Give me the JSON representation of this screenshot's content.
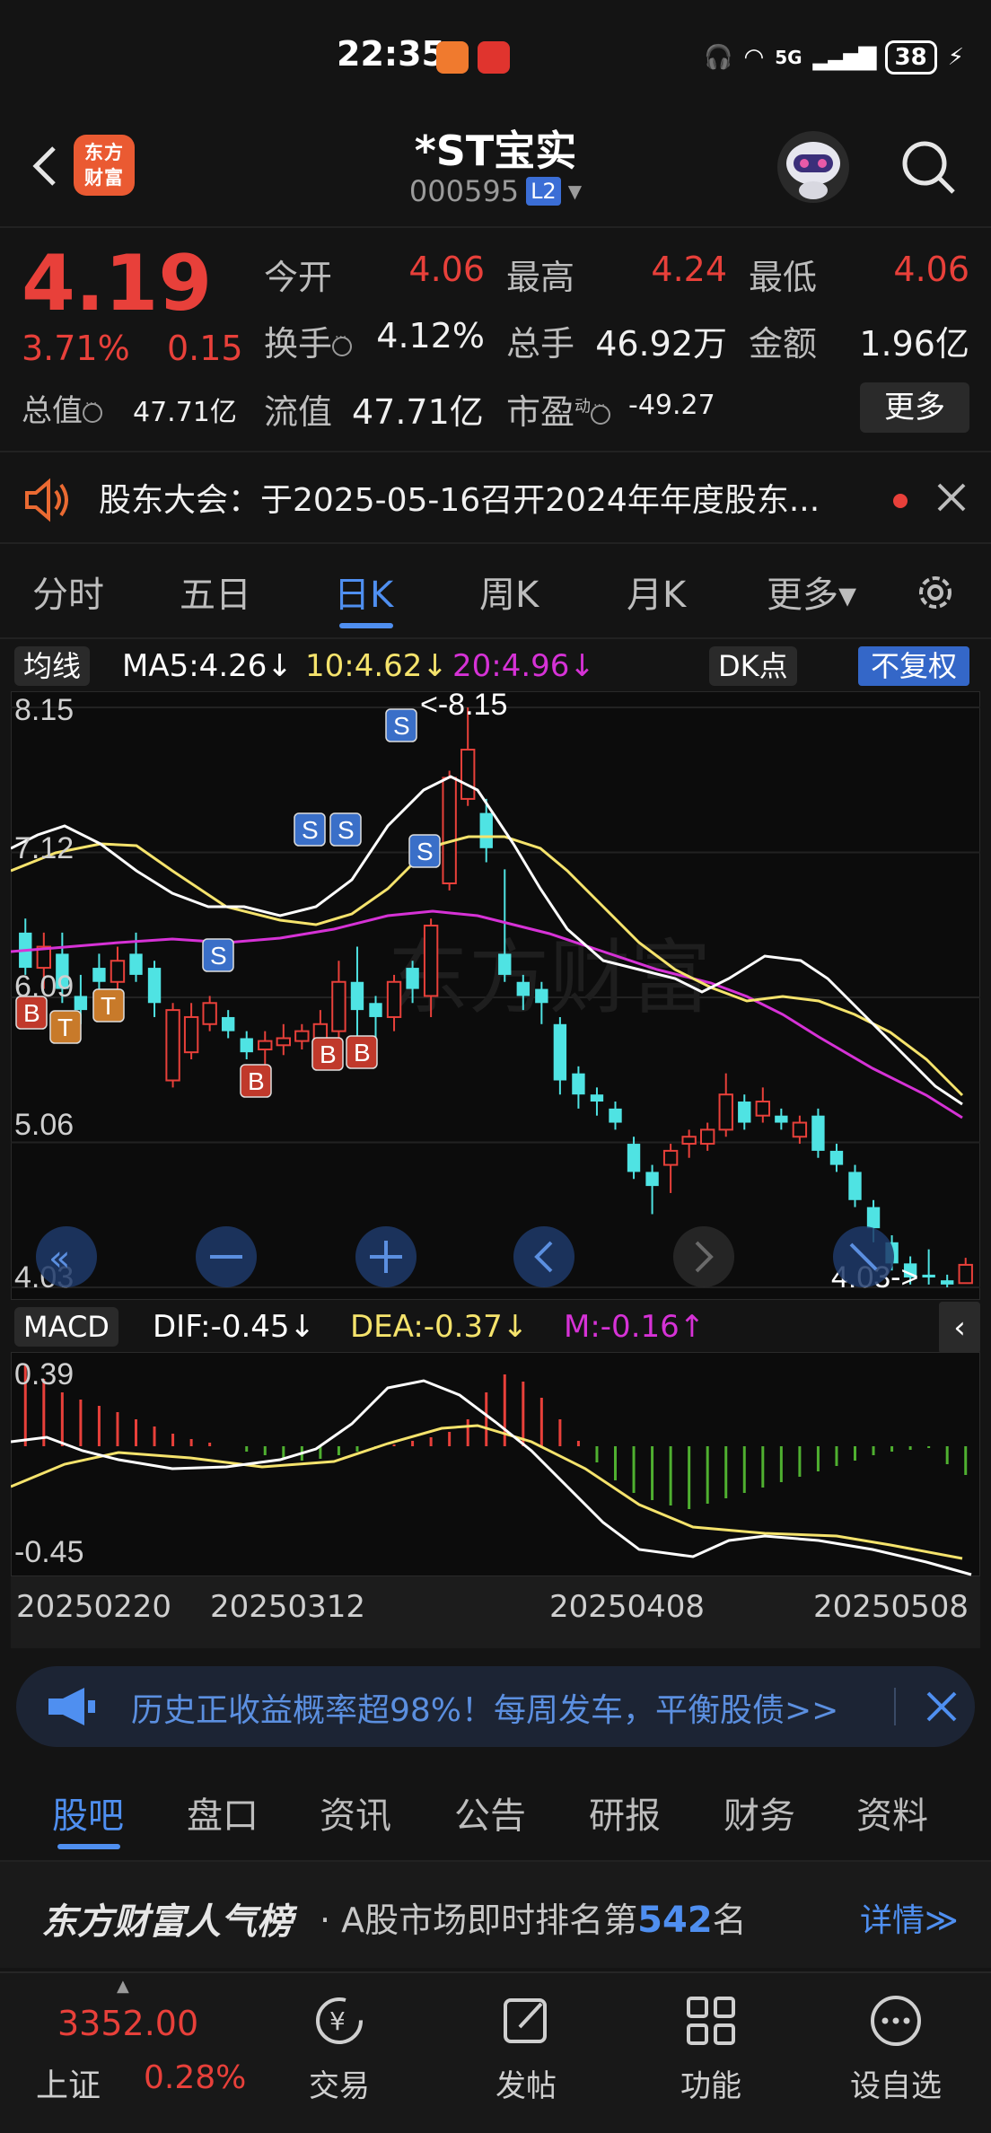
{
  "status": {
    "time": "22:35",
    "network": "5G",
    "battery": "38"
  },
  "header": {
    "name": "*ST宝实",
    "code": "000595",
    "level": "L2",
    "logo_line1": "东方",
    "logo_line2": "财富"
  },
  "quote": {
    "price": "4.19",
    "pct": "3.71%",
    "change": "0.15",
    "open_label": "今开",
    "open": "4.06",
    "high_label": "最高",
    "high": "4.24",
    "low_label": "最低",
    "low": "4.06",
    "turnover_label": "换手",
    "turnover": "4.12%",
    "volume_label": "总手",
    "volume": "46.92万",
    "amount_label": "金额",
    "amount": "1.96亿",
    "mktcap_label": "总值",
    "mktcap": "47.71亿",
    "float_label": "流值",
    "float": "47.71亿",
    "pe_label": "市盈",
    "pe_sup": "动",
    "pe": "-49.27",
    "more": "更多"
  },
  "notice": {
    "text": "股东大会：于2025-05-16召开2024年年度股东..."
  },
  "chart_tabs": [
    "分时",
    "五日",
    "日K",
    "周K",
    "月K",
    "更多▾"
  ],
  "ma": {
    "label": "均线",
    "ma5": "MA5:4.26↓",
    "ma10": "10:4.62↓",
    "ma20": "20:4.96↓",
    "dk": "DK点",
    "adjust": "不复权"
  },
  "kchart": {
    "y_ticks": [
      "8.15",
      "7.12",
      "6.09",
      "5.06",
      "4.03"
    ],
    "max_label": "<-8.15",
    "min_label": "4.03->"
  },
  "macd": {
    "label": "MACD",
    "dif": "DIF:-0.45↓",
    "dea": "DEA:-0.37↓",
    "m": "M:-0.16↑",
    "top": "0.39",
    "bottom": "-0.45"
  },
  "dates": [
    "20250220",
    "20250312",
    "20250408",
    "20250508"
  ],
  "promo": {
    "text": "历史正收益概率超98%！每周发车，平衡股债>>"
  },
  "bottom_tabs": [
    "股吧",
    "盘口",
    "资讯",
    "公告",
    "研报",
    "财务",
    "资料"
  ],
  "popularity": {
    "brand": "东方财富人气榜",
    "prefix": "· A股市场即时排名第",
    "rank": "542",
    "suffix": "名",
    "detail": "详情≫"
  },
  "nav": {
    "index_value": "3352.00",
    "index_name": "上证",
    "index_pct": "0.28%",
    "items": [
      "交易",
      "发帖",
      "功能",
      "设自选"
    ]
  },
  "colors": {
    "up": "#e8403a",
    "down": "#4fe3e3",
    "accent": "#4f8ff0",
    "ma5": "#ffffff",
    "ma10": "#f5e36c",
    "ma20": "#d632d6"
  },
  "chart_data": {
    "type": "candlestick",
    "ylim": [
      4.03,
      8.15
    ],
    "candles": [
      [
        6.55,
        6.3,
        6.65,
        6.25
      ],
      [
        6.3,
        6.45,
        6.55,
        6.15
      ],
      [
        6.4,
        6.15,
        6.55,
        6.05
      ],
      [
        6.1,
        6.0,
        6.25,
        5.9
      ],
      [
        6.3,
        6.2,
        6.4,
        6.1
      ],
      [
        6.2,
        6.35,
        6.45,
        6.1
      ],
      [
        6.4,
        6.25,
        6.55,
        6.2
      ],
      [
        6.3,
        6.05,
        6.35,
        5.95
      ],
      [
        5.5,
        6.0,
        6.05,
        5.45
      ],
      [
        5.7,
        5.95,
        6.05,
        5.65
      ],
      [
        5.9,
        6.05,
        6.1,
        5.85
      ],
      [
        5.95,
        5.85,
        6.0,
        5.8
      ],
      [
        5.8,
        5.7,
        5.85,
        5.65
      ],
      [
        5.72,
        5.78,
        5.85,
        5.6
      ],
      [
        5.75,
        5.8,
        5.9,
        5.68
      ],
      [
        5.78,
        5.85,
        5.9,
        5.72
      ],
      [
        5.8,
        5.9,
        6.0,
        5.75
      ],
      [
        5.85,
        6.2,
        6.35,
        5.8
      ],
      [
        6.2,
        6.0,
        6.45,
        5.75
      ],
      [
        6.05,
        5.95,
        6.1,
        5.8
      ],
      [
        5.95,
        6.2,
        6.25,
        5.85
      ],
      [
        6.3,
        6.15,
        6.35,
        6.05
      ],
      [
        6.1,
        6.6,
        6.65,
        5.95
      ],
      [
        6.9,
        7.65,
        7.7,
        6.85
      ],
      [
        7.5,
        7.85,
        8.15,
        7.45
      ],
      [
        7.4,
        7.15,
        7.5,
        7.05
      ],
      [
        6.4,
        6.25,
        7.0,
        6.2
      ],
      [
        6.2,
        6.1,
        6.25,
        6.0
      ],
      [
        6.15,
        6.05,
        6.2,
        5.9
      ],
      [
        5.9,
        5.5,
        5.95,
        5.4
      ],
      [
        5.55,
        5.4,
        5.6,
        5.3
      ],
      [
        5.4,
        5.35,
        5.45,
        5.25
      ],
      [
        5.3,
        5.2,
        5.35,
        5.15
      ],
      [
        5.05,
        4.85,
        5.1,
        4.8
      ],
      [
        4.85,
        4.75,
        4.9,
        4.55
      ],
      [
        4.9,
        5.0,
        5.05,
        4.7
      ],
      [
        5.05,
        5.1,
        5.15,
        4.95
      ],
      [
        5.05,
        5.15,
        5.2,
        5.0
      ],
      [
        5.15,
        5.4,
        5.55,
        5.1
      ],
      [
        5.35,
        5.2,
        5.4,
        5.15
      ],
      [
        5.25,
        5.35,
        5.45,
        5.2
      ],
      [
        5.25,
        5.2,
        5.3,
        5.15
      ],
      [
        5.1,
        5.2,
        5.25,
        5.05
      ],
      [
        5.25,
        5.0,
        5.3,
        4.95
      ],
      [
        5.0,
        4.9,
        5.05,
        4.85
      ],
      [
        4.85,
        4.65,
        4.9,
        4.6
      ],
      [
        4.6,
        4.45,
        4.65,
        4.35
      ],
      [
        4.35,
        4.2,
        4.4,
        4.15
      ],
      [
        4.2,
        4.1,
        4.25,
        4.05
      ],
      [
        4.12,
        4.1,
        4.3,
        4.05
      ],
      [
        4.08,
        4.05,
        4.12,
        4.03
      ],
      [
        4.06,
        4.19,
        4.24,
        4.06
      ]
    ]
  }
}
